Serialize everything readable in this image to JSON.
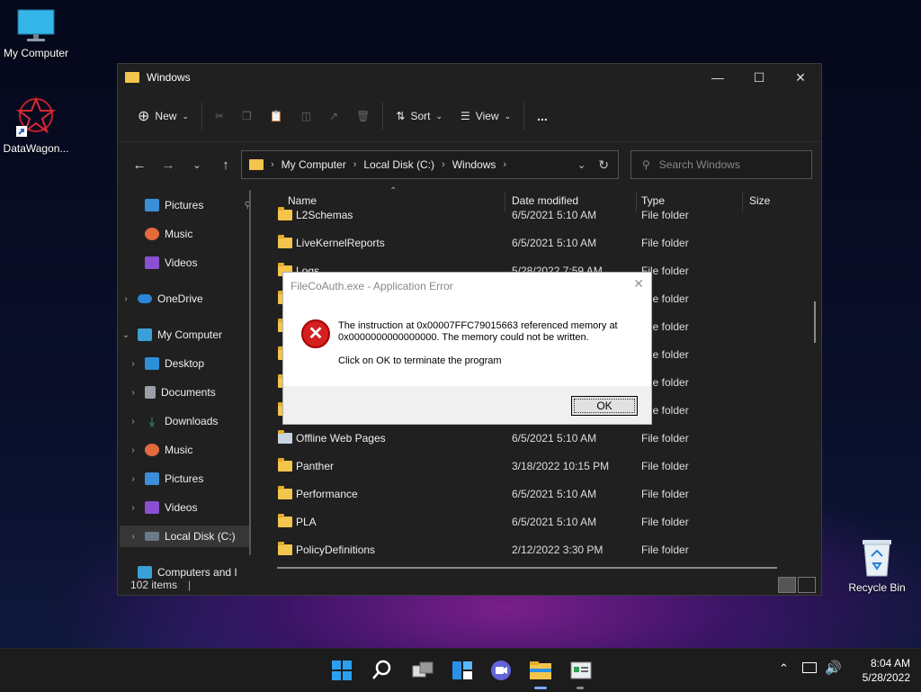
{
  "desktop": {
    "icons": [
      {
        "label": "My Computer",
        "icon": "monitor-icon"
      },
      {
        "label": "DataWagon...",
        "icon": "app-shortcut-icon"
      },
      {
        "label": "Recycle Bin",
        "icon": "recycle-bin-icon"
      }
    ]
  },
  "explorer": {
    "title": "Windows",
    "toolbar": {
      "new_label": "New",
      "sort_label": "Sort",
      "view_label": "View",
      "more_label": "..."
    },
    "breadcrumb": [
      "My Computer",
      "Local Disk (C:)",
      "Windows"
    ],
    "search_placeholder": "Search Windows",
    "nav_items": [
      {
        "label": "Pictures",
        "icon": "pictures-icon",
        "color": "#3b8fd9"
      },
      {
        "label": "Music",
        "icon": "music-icon",
        "color": "#e26a3c"
      },
      {
        "label": "Videos",
        "icon": "videos-icon",
        "color": "#8b4fd1"
      },
      {
        "label": "OneDrive",
        "icon": "cloud-icon",
        "color": "#2a86d8"
      },
      {
        "label": "My Computer",
        "icon": "monitor-icon",
        "color": "#3aa0d8"
      },
      {
        "label": "Desktop",
        "icon": "desktop-icon",
        "color": "#2d8fd6"
      },
      {
        "label": "Documents",
        "icon": "documents-icon",
        "color": "#9aa0a8"
      },
      {
        "label": "Downloads",
        "icon": "download-icon",
        "color": "#2fb36a"
      },
      {
        "label": "Music",
        "icon": "music-icon",
        "color": "#e26a3c"
      },
      {
        "label": "Pictures",
        "icon": "pictures-icon",
        "color": "#3b8fd9"
      },
      {
        "label": "Videos",
        "icon": "videos-icon",
        "color": "#8b4fd1"
      },
      {
        "label": "Local Disk (C:)",
        "icon": "drive-icon",
        "color": "#6a7a8a"
      },
      {
        "label": "Computers and I",
        "icon": "network-icon",
        "color": "#3aa0d8"
      }
    ],
    "columns": [
      "Name",
      "Date modified",
      "Type",
      "Size"
    ],
    "rows": [
      {
        "name": "L2Schemas",
        "date": "6/5/2021 5:10 AM",
        "type": "File folder"
      },
      {
        "name": "LiveKernelReports",
        "date": "6/5/2021 5:10 AM",
        "type": "File folder"
      },
      {
        "name": "Logs",
        "date": "5/28/2022 7:59 AM",
        "type": "File folder"
      },
      {
        "name": "",
        "date": "",
        "type": "File folder"
      },
      {
        "name": "",
        "date": "",
        "type": "File folder"
      },
      {
        "name": "",
        "date": "",
        "type": "File folder"
      },
      {
        "name": "",
        "date": "",
        "type": "File folder"
      },
      {
        "name": "",
        "date": "",
        "type": "File folder"
      },
      {
        "name": "Offline Web Pages",
        "date": "6/5/2021 5:10 AM",
        "type": "File folder"
      },
      {
        "name": "Panther",
        "date": "3/18/2022 10:15 PM",
        "type": "File folder"
      },
      {
        "name": "Performance",
        "date": "6/5/2021 5:10 AM",
        "type": "File folder"
      },
      {
        "name": "PLA",
        "date": "6/5/2021 5:10 AM",
        "type": "File folder"
      },
      {
        "name": "PolicyDefinitions",
        "date": "2/12/2022 3:30 PM",
        "type": "File folder"
      }
    ],
    "status": "102 items"
  },
  "dialog": {
    "title": "FileCoAuth.exe - Application Error",
    "message": "The instruction at 0x00007FFC79015663 referenced memory at 0x0000000000000000. The memory could not be written.",
    "message2": "Click on OK to terminate the program",
    "ok_label": "OK"
  },
  "taskbar": {
    "time": "8:04 AM",
    "date": "5/28/2022"
  }
}
